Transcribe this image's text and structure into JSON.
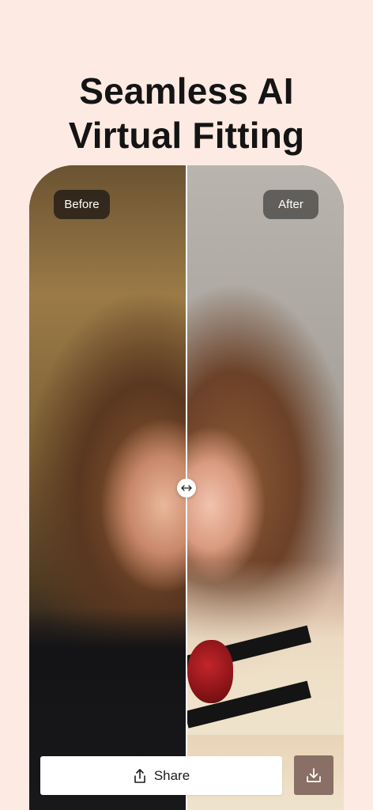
{
  "headline": {
    "line1": "Seamless AI",
    "line2": "Virtual Fitting"
  },
  "compare": {
    "before_label": "Before",
    "after_label": "After",
    "slider_position": 0.5
  },
  "actions": {
    "share_label": "Share",
    "share_icon": "share-icon",
    "download_icon": "download-icon"
  },
  "colors": {
    "background": "#fdeae3",
    "download_button": "#8a6f66"
  }
}
